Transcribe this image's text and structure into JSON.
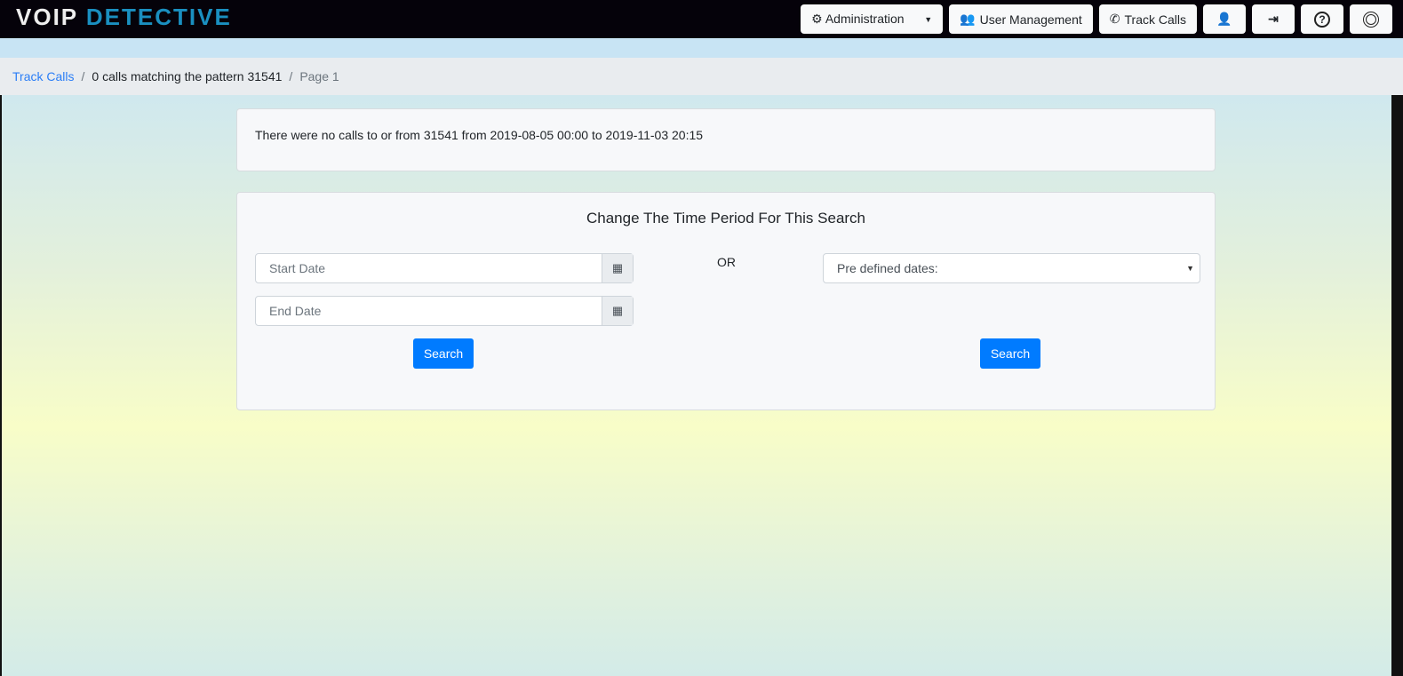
{
  "header": {
    "logo": {
      "part1": "VOIP",
      "part2": "DETECTIVE"
    },
    "nav": [
      {
        "label": "Administration",
        "icon": "gears-icon"
      },
      {
        "label": "User Management",
        "icon": "users-icon"
      },
      {
        "label": "Track Calls",
        "icon": "phone-icon"
      }
    ],
    "icon_buttons": [
      "user-settings-icon",
      "sign-out-icon",
      "help-icon",
      "life-ring-icon"
    ]
  },
  "breadcrumb": {
    "link": "Track Calls",
    "current": "0 calls matching the pattern 31541",
    "page": "Page 1"
  },
  "message": "There were no calls to or from 31541 from 2019-08-05 00:00 to 2019-11-03 20:15",
  "form": {
    "title": "Change The Time Period For This Search",
    "start_placeholder": "Start Date",
    "end_placeholder": "End Date",
    "or": "OR",
    "predefined": "Pre defined dates:",
    "search1": "Search",
    "search2": "Search"
  }
}
